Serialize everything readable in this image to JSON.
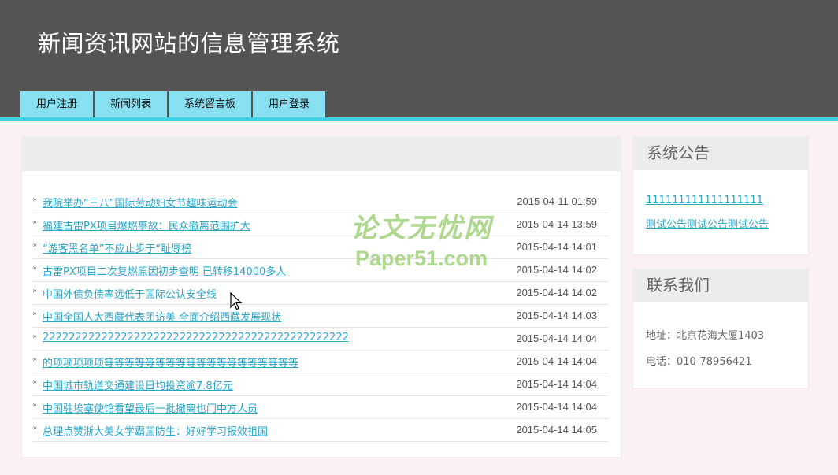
{
  "header": {
    "title": "新闻资讯网站的信息管理系统"
  },
  "nav": {
    "tabs": [
      {
        "label": "用户注册"
      },
      {
        "label": "新闻列表"
      },
      {
        "label": "系统留言板"
      },
      {
        "label": "用户登录"
      }
    ]
  },
  "news": [
    {
      "title": "我院举办“三八”国际劳动妇女节趣味运动会",
      "date": "2015-04-11 01:59"
    },
    {
      "title": "福建古雷PX项目爆燃事故：民众撤离范围扩大",
      "date": "2015-04-14 13:59"
    },
    {
      "title": "“游客黑名单”不应止步于“耻辱榜",
      "date": "2015-04-14 14:01"
    },
    {
      "title": "古雷PX项目二次复燃原因初步查明 已转移14000多人",
      "date": "2015-04-14 14:02"
    },
    {
      "title": "中国外债负债率远低于国际公认安全线",
      "date": "2015-04-14 14:02"
    },
    {
      "title": "中国全国人大西藏代表团访美 全面介绍西藏发展现状",
      "date": "2015-04-14 14:03"
    },
    {
      "title": "22222222222222222222222222222222222222222222222",
      "date": "2015-04-14 14:04"
    },
    {
      "title": "的项项项项项等等等等等等等等等等等等等等等等等等等",
      "date": "2015-04-14 14:04"
    },
    {
      "title": "中国城市轨道交通建设日均投资逾7.8亿元",
      "date": "2015-04-14 14:04"
    },
    {
      "title": "中国驻埃塞使馆看望最后一批撤离也门中方人员",
      "date": "2015-04-14 14:04"
    },
    {
      "title": "总理点赞浙大美女学霸国防生：好好学习报效祖国",
      "date": "2015-04-14 14:05"
    }
  ],
  "sidebar": {
    "notice": {
      "title": "系统公告",
      "items": [
        {
          "label": "111111111111111111"
        },
        {
          "label": "测试公告测试公告测试公告"
        }
      ]
    },
    "contact": {
      "title": "联系我们",
      "address": "地址：北京花海大厦1403",
      "phone": "电话：010-78956421"
    }
  },
  "watermark": {
    "cn": "论文无忧网",
    "en": "Paper51.com"
  },
  "colors": {
    "header_bg": "#545452",
    "accent": "#3fd0e6",
    "tab_bg": "#87dff0",
    "link": "#2aa6c6"
  }
}
